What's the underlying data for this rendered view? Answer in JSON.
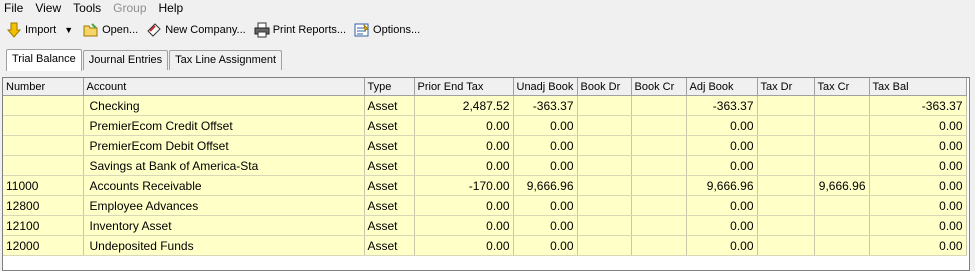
{
  "menu": [
    "File",
    "View",
    "Tools",
    "Group",
    "Help"
  ],
  "menu_disabled": [
    "Group"
  ],
  "toolbar": {
    "import_label": "Import",
    "open_label": "Open...",
    "new_company_label": "New Company...",
    "print_reports_label": "Print Reports...",
    "options_label": "Options..."
  },
  "tabs": [
    "Trial Balance",
    "Journal Entries",
    "Tax Line Assignment"
  ],
  "active_tab": "Trial Balance",
  "grid": {
    "columns": [
      "Number",
      "Account",
      "Type",
      "Prior End Tax",
      "Unadj Book",
      "Book Dr",
      "Book Cr",
      "Adj Book",
      "Tax Dr",
      "Tax Cr",
      "Tax Bal"
    ],
    "rows": [
      [
        "",
        "Checking",
        "Asset",
        "2,487.52",
        "-363.37",
        "",
        "",
        "-363.37",
        "",
        "",
        "-363.37"
      ],
      [
        "",
        "PremierEcom Credit Offset",
        "Asset",
        "0.00",
        "0.00",
        "",
        "",
        "0.00",
        "",
        "",
        "0.00"
      ],
      [
        "",
        "PremierEcom Debit Offset",
        "Asset",
        "0.00",
        "0.00",
        "",
        "",
        "0.00",
        "",
        "",
        "0.00"
      ],
      [
        "",
        "Savings at Bank of America-Sta",
        "Asset",
        "0.00",
        "0.00",
        "",
        "",
        "0.00",
        "",
        "",
        "0.00"
      ],
      [
        "11000",
        "Accounts Receivable",
        "Asset",
        "-170.00",
        "9,666.96",
        "",
        "",
        "9,666.96",
        "",
        "9,666.96",
        "0.00"
      ],
      [
        "12800",
        "Employee Advances",
        "Asset",
        "0.00",
        "0.00",
        "",
        "",
        "0.00",
        "",
        "",
        "0.00"
      ],
      [
        "12100",
        "Inventory Asset",
        "Asset",
        "0.00",
        "0.00",
        "",
        "",
        "0.00",
        "",
        "",
        "0.00"
      ],
      [
        "12000",
        "Undeposited Funds",
        "Asset",
        "0.00",
        "0.00",
        "",
        "",
        "0.00",
        "",
        "",
        "0.00"
      ]
    ],
    "row_color": "#ffffc8"
  }
}
